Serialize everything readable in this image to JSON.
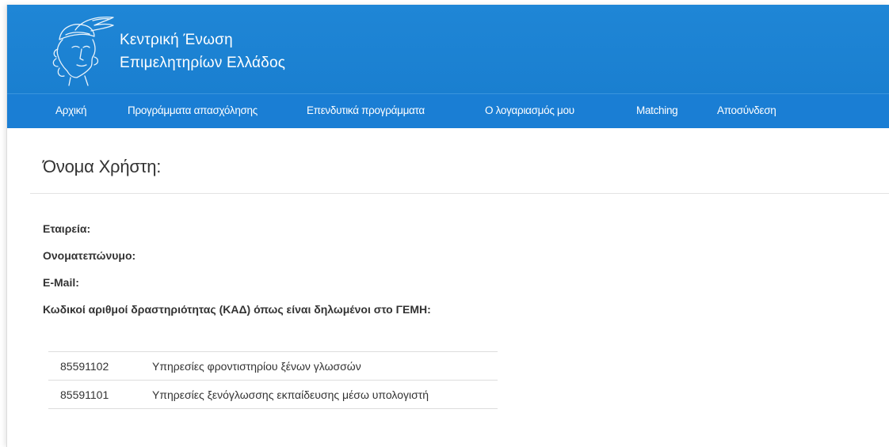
{
  "header": {
    "brand_line1": "Κεντρική Ένωση",
    "brand_line2": "Επιμελητηρίων Ελλάδος",
    "logo_icon": "hermes-head-logo",
    "background_color": "#1a7fd0"
  },
  "nav": {
    "items": [
      {
        "label": "Αρχική"
      },
      {
        "label": "Προγράμματα απασχόλησης"
      },
      {
        "label": "Επενδυτικά προγράμματα"
      },
      {
        "label": "Ο λογαριασμός μου"
      },
      {
        "label": "Matching"
      },
      {
        "label": "Αποσύνδεση"
      }
    ]
  },
  "main": {
    "title": "Όνομα Χρήστη:",
    "fields": {
      "company_label": "Εταιρεία:",
      "fullname_label": "Ονοματεπώνυμο:",
      "email_label": "E-Mail:",
      "kad_label": "Κωδικοί αριθμοί δραστηριότητας (ΚΑΔ) όπως είναι δηλωμένοι στο ΓΕΜΗ:"
    },
    "kad_rows": [
      {
        "code": "85591102",
        "description": "Υπηρεσίες φροντιστηρίου ξένων γλωσσών"
      },
      {
        "code": "85591101",
        "description": "Υπηρεσίες ξενόγλωσσης εκπαίδευσης μέσω υπολογιστή"
      }
    ]
  }
}
